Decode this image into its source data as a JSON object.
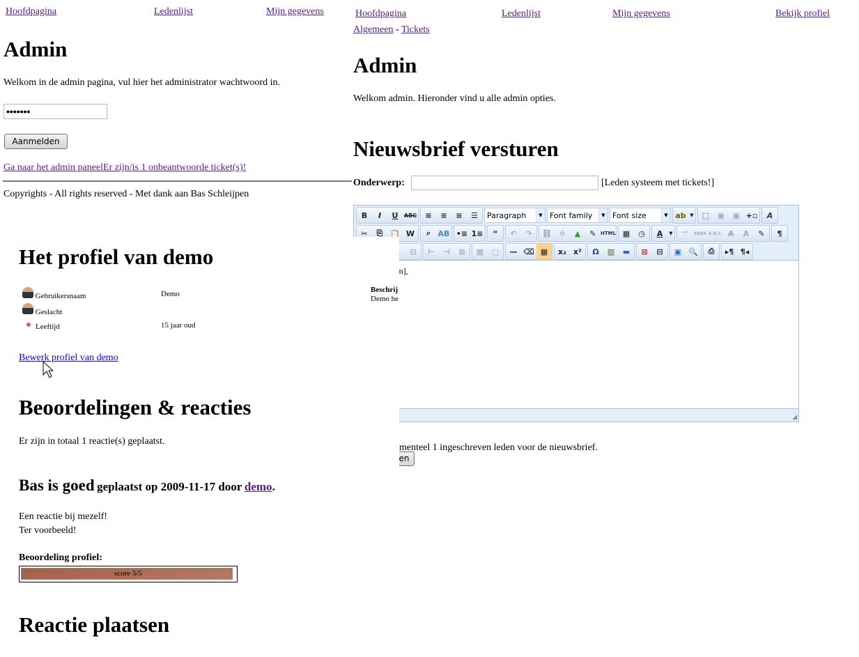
{
  "admin_panel_page": {
    "nav": [
      "Hoofdpagina",
      "Ledenlijst",
      "Mijn gegevens",
      "Bekijk profiel"
    ],
    "subnav": {
      "general": "Algemeen",
      "separator": "-",
      "tickets": "Tickets"
    },
    "title": "Admin",
    "welcome": "Welkom admin. Hieronder vind u alle admin opties.",
    "newsletter_title": "Nieuwsbrief versturen",
    "subject_label": "Onderwerp:",
    "subject_value": "",
    "subject_hint": "[Leden systeem met tickets!]",
    "editor": {
      "format_select": "Paragraph",
      "font_family_select": "Font family",
      "font_size_select": "Font size",
      "content_fragment_1": "am],",
      "content_fragment_2": "Beschrij",
      "content_fragment_3": "Demo he"
    },
    "subscribers_fragment": "menteel 1 ingeschreven leden voor de nieuwsbrief.",
    "send_button_fragment": "en"
  },
  "admin_login_page": {
    "nav": [
      "Hoofdpagina",
      "Ledenlijst",
      "Mijn gegevens"
    ],
    "title": "Admin",
    "intro": "Welkom in de admin pagina, vul hier het administrator wachtwoord in.",
    "password_value": "•••••••",
    "login_button": "Aanmelden",
    "admin_link": "Ga naar het admin paneelEr zijn/is 1 onbeantwoorde ticket(s)!",
    "footer": "Copyrights - All rights reserved - Met dank aan Bas Schleijpen"
  },
  "profile_page": {
    "title": "Het profiel van demo",
    "fields": [
      {
        "label": "Gebruikersnaam",
        "value": "Demo",
        "icon": "user-icon"
      },
      {
        "label": "Geslacht",
        "value": "",
        "icon": "user-icon"
      },
      {
        "label": "Leeftijd",
        "value": "15 jaar oud",
        "icon": "red-dot-icon"
      }
    ],
    "edit_link": "Bewerk profiel van demo",
    "reviews_title": "Beoordelingen & reacties",
    "reviews_count": "Er zijn in totaal 1 reactie(s) geplaatst.",
    "comment": {
      "title": "Bas is goed",
      "meta_prefix": "geplaatst op 2009-11-17 door",
      "author": "demo",
      "meta_suffix": ".",
      "line1": "Een reactie bij mezelf!",
      "line2": "Ter voorbeeld!"
    },
    "rating_label": "Beoordeling profiel:",
    "rating_text": "score 5/5",
    "rating_fraction": 1.0,
    "post_title": "Reactie plaatsen"
  },
  "colors": {
    "link": "#551a8b",
    "unvisited_link": "#0000ee",
    "rating_bar": "#a9674f",
    "editor_bg": "#e4eefa"
  }
}
